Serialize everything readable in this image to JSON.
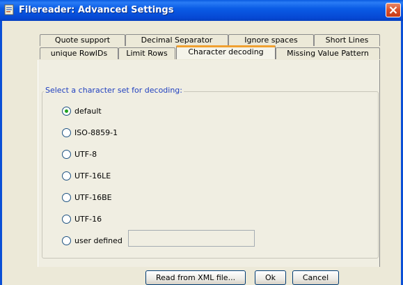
{
  "window": {
    "title": "Filereader: Advanced Settings",
    "title_bar_color": "#0a5be0"
  },
  "tabs": {
    "row1": [
      "Quote support",
      "Decimal Separator",
      "Ignore spaces",
      "Short Lines"
    ],
    "row2": [
      "unique RowIDs",
      "Limit Rows",
      "Character decoding",
      "Missing Value Pattern"
    ],
    "selected": "Character decoding"
  },
  "charset_group": {
    "title": "Select a character set for decoding:",
    "options": [
      "default",
      "ISO-8859-1",
      "UTF-8",
      "UTF-16LE",
      "UTF-16BE",
      "UTF-16",
      "user defined"
    ],
    "selected": "default",
    "user_defined_value": ""
  },
  "buttons": {
    "read_xml": "Read from XML file...",
    "ok": "Ok",
    "cancel": "Cancel"
  },
  "icons": {
    "app": "app-icon",
    "close": "close-icon"
  },
  "colors": {
    "accent_tab": "#f0a030",
    "group_title": "#1f3fbf",
    "radio_checked": "#21a121"
  }
}
